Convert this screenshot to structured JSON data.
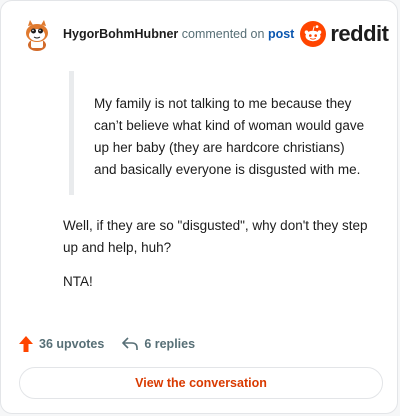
{
  "header": {
    "username": "HygorBohmHubner",
    "action_text": "commented on",
    "post_link": "post",
    "brand": "reddit",
    "avatar_icon": "snoo-avatar-icon",
    "brand_icon": "reddit-alien-icon"
  },
  "quote": {
    "text": "My family is not talking to me because they can’t believe what kind of woman would gave up her baby (they are hardcore christians) and basically everyone is disgusted with me."
  },
  "comment": {
    "paragraph1": "Well, if they are so \"disgusted\", why don't they step up and help, huh?",
    "paragraph2": "NTA!"
  },
  "footer": {
    "upvotes": "36 upvotes",
    "replies": "6 replies",
    "upvote_icon": "upvote-arrow-icon",
    "reply_icon": "reply-arrow-icon"
  },
  "cta": {
    "label": "View the conversation"
  },
  "colors": {
    "accent": "#ff4500",
    "cta_text": "#d93a00",
    "link": "#0b57b0",
    "muted": "#576f76"
  }
}
